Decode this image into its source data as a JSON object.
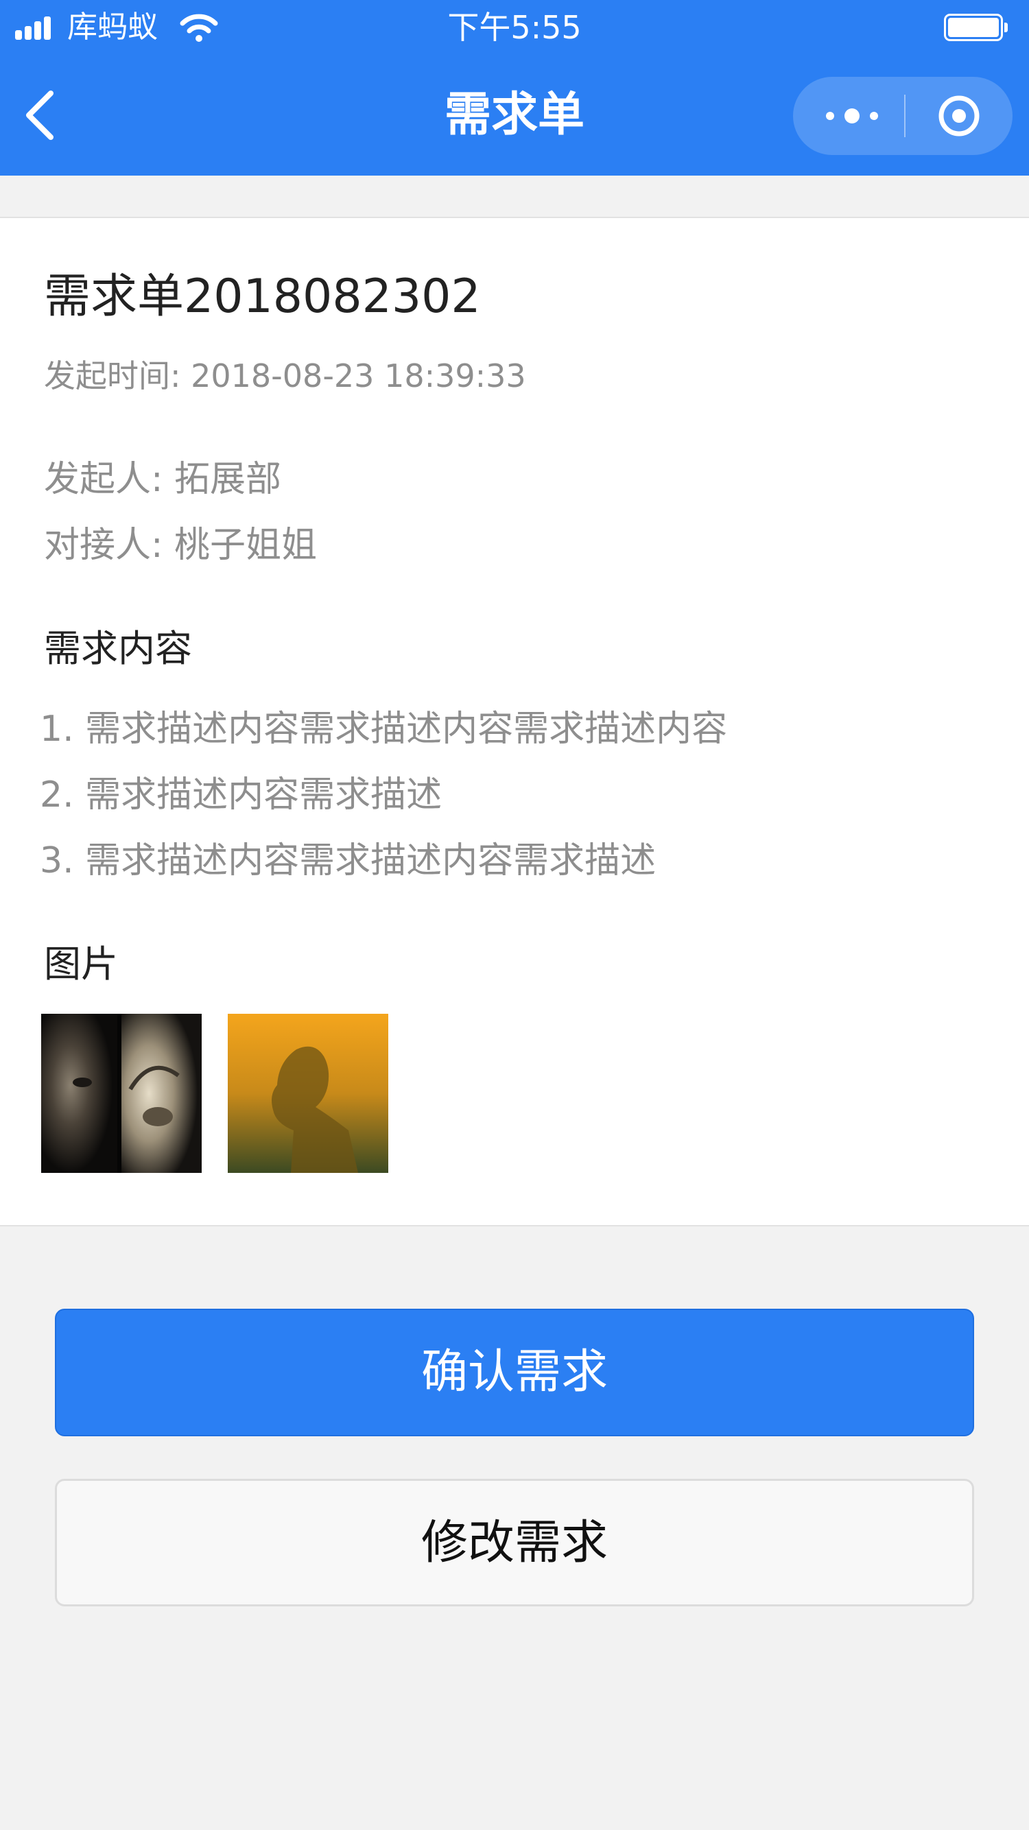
{
  "status_bar": {
    "carrier": "库蚂蚁",
    "time": "下午5:55",
    "battery_level": 1.0
  },
  "nav": {
    "title": "需求单",
    "back_icon": "chevron-left-icon",
    "more_icon": "more-dots-icon",
    "close_icon": "target-circle-icon"
  },
  "order": {
    "title": "需求单2018082302",
    "created_at": "发起时间: 2018-08-23 18:39:33",
    "initiator": "发起人: 拓展部",
    "contact": "对接人: 桃子姐姐"
  },
  "content": {
    "heading": "需求内容",
    "items": [
      "1. 需求描述内容需求描述内容需求描述内容",
      "2. 需求描述内容需求描述",
      "3. 需求描述内容需求描述内容需求描述"
    ]
  },
  "images": {
    "heading": "图片"
  },
  "actions": {
    "confirm_label": "确认需求",
    "modify_label": "修改需求"
  },
  "colors": {
    "primary": "#2b7ff3",
    "page_bg": "#f2f2f2",
    "muted_text": "#8e8e8e"
  }
}
